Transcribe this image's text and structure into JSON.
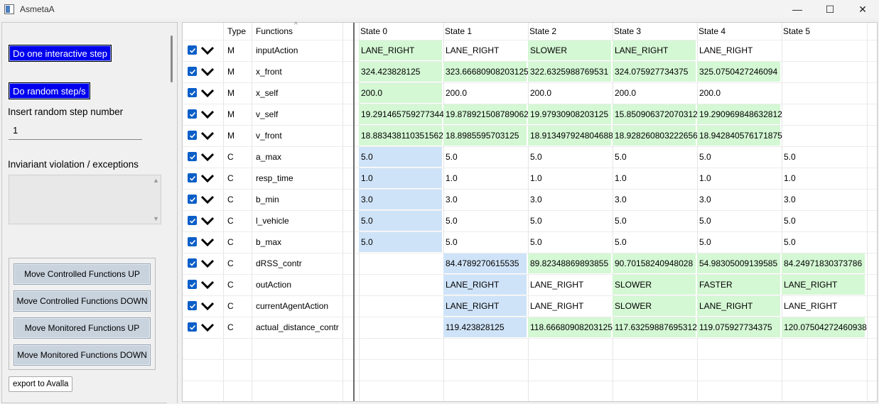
{
  "window": {
    "title": "AsmetaA",
    "minimize": "—",
    "maximize": "☐",
    "close": "✕"
  },
  "left": {
    "interactive_step_label": "Do one interactive step",
    "random_step_label": "Do random step/s",
    "random_step_number_label": "Insert random step number",
    "random_step_number_value": "1",
    "violation_label": "Inviariant violation / exceptions",
    "move_buttons": [
      "Move Controlled Functions UP",
      "Move Controlled Functions DOWN",
      "Move Monitored Functions UP",
      "Move Monitored Functions DOWN"
    ],
    "export_label": "export to Avalla"
  },
  "table": {
    "col_type": "Type",
    "col_functions": "Functions",
    "states": [
      "State 0",
      "State 1",
      "State 2",
      "State 3",
      "State 4",
      "State 5"
    ],
    "colors": {
      "green": "#d4f7d4",
      "blue": "#cfe3f8"
    },
    "rows": [
      {
        "type": "M",
        "name": "inputAction",
        "cells": [
          {
            "v": "LANE_RIGHT",
            "c": "green"
          },
          {
            "v": "LANE_RIGHT",
            "c": ""
          },
          {
            "v": "SLOWER",
            "c": "green"
          },
          {
            "v": "LANE_RIGHT",
            "c": "green"
          },
          {
            "v": "LANE_RIGHT",
            "c": ""
          },
          {
            "v": "",
            "c": ""
          }
        ]
      },
      {
        "type": "M",
        "name": "x_front",
        "cells": [
          {
            "v": "324.423828125",
            "c": "green"
          },
          {
            "v": "323.66680908203125",
            "c": "green"
          },
          {
            "v": "322.6325988769531",
            "c": "green"
          },
          {
            "v": "324.075927734375",
            "c": "green"
          },
          {
            "v": "325.0750427246094",
            "c": "green"
          },
          {
            "v": "",
            "c": ""
          }
        ]
      },
      {
        "type": "M",
        "name": "x_self",
        "cells": [
          {
            "v": "200.0",
            "c": "green"
          },
          {
            "v": "200.0",
            "c": ""
          },
          {
            "v": "200.0",
            "c": ""
          },
          {
            "v": "200.0",
            "c": ""
          },
          {
            "v": "200.0",
            "c": ""
          },
          {
            "v": "",
            "c": ""
          }
        ]
      },
      {
        "type": "M",
        "name": "v_self",
        "cells": [
          {
            "v": "19.291465759277344",
            "c": "green"
          },
          {
            "v": "19.878921508789062",
            "c": "green"
          },
          {
            "v": "19.97930908203125",
            "c": "green"
          },
          {
            "v": "15.850906372070312",
            "c": "green"
          },
          {
            "v": "19.290969848632812",
            "c": "green"
          },
          {
            "v": "",
            "c": ""
          }
        ]
      },
      {
        "type": "M",
        "name": "v_front",
        "cells": [
          {
            "v": "18.883438110351562",
            "c": "green"
          },
          {
            "v": "18.8985595703125",
            "c": "green"
          },
          {
            "v": "18.913497924804688",
            "c": "green"
          },
          {
            "v": "18.928260803222656",
            "c": "green"
          },
          {
            "v": "18.942840576171875",
            "c": "green"
          },
          {
            "v": "",
            "c": ""
          }
        ]
      },
      {
        "type": "C",
        "name": "a_max",
        "cells": [
          {
            "v": "5.0",
            "c": "blue"
          },
          {
            "v": "5.0",
            "c": ""
          },
          {
            "v": "5.0",
            "c": ""
          },
          {
            "v": "5.0",
            "c": ""
          },
          {
            "v": "5.0",
            "c": ""
          },
          {
            "v": "5.0",
            "c": ""
          }
        ]
      },
      {
        "type": "C",
        "name": "resp_time",
        "cells": [
          {
            "v": "1.0",
            "c": "blue"
          },
          {
            "v": "1.0",
            "c": ""
          },
          {
            "v": "1.0",
            "c": ""
          },
          {
            "v": "1.0",
            "c": ""
          },
          {
            "v": "1.0",
            "c": ""
          },
          {
            "v": "1.0",
            "c": ""
          }
        ]
      },
      {
        "type": "C",
        "name": "b_min",
        "cells": [
          {
            "v": "3.0",
            "c": "blue"
          },
          {
            "v": "3.0",
            "c": ""
          },
          {
            "v": "3.0",
            "c": ""
          },
          {
            "v": "3.0",
            "c": ""
          },
          {
            "v": "3.0",
            "c": ""
          },
          {
            "v": "3.0",
            "c": ""
          }
        ]
      },
      {
        "type": "C",
        "name": "l_vehicle",
        "cells": [
          {
            "v": "5.0",
            "c": "blue"
          },
          {
            "v": "5.0",
            "c": ""
          },
          {
            "v": "5.0",
            "c": ""
          },
          {
            "v": "5.0",
            "c": ""
          },
          {
            "v": "5.0",
            "c": ""
          },
          {
            "v": "5.0",
            "c": ""
          }
        ]
      },
      {
        "type": "C",
        "name": "b_max",
        "cells": [
          {
            "v": "5.0",
            "c": "blue"
          },
          {
            "v": "5.0",
            "c": ""
          },
          {
            "v": "5.0",
            "c": ""
          },
          {
            "v": "5.0",
            "c": ""
          },
          {
            "v": "5.0",
            "c": ""
          },
          {
            "v": "5.0",
            "c": ""
          }
        ]
      },
      {
        "type": "C",
        "name": "dRSS_contr",
        "cells": [
          {
            "v": "",
            "c": ""
          },
          {
            "v": "84.4789270615535",
            "c": "blue"
          },
          {
            "v": "89.82348869893855",
            "c": "green"
          },
          {
            "v": "90.70158240948028",
            "c": "green"
          },
          {
            "v": "54.98305009139585",
            "c": "green"
          },
          {
            "v": "84.24971830373786",
            "c": "green"
          }
        ]
      },
      {
        "type": "C",
        "name": "outAction",
        "cells": [
          {
            "v": "",
            "c": ""
          },
          {
            "v": "LANE_RIGHT",
            "c": "blue"
          },
          {
            "v": "LANE_RIGHT",
            "c": ""
          },
          {
            "v": "SLOWER",
            "c": "green"
          },
          {
            "v": "FASTER",
            "c": "green"
          },
          {
            "v": "LANE_RIGHT",
            "c": "green"
          }
        ]
      },
      {
        "type": "C",
        "name": "currentAgentAction",
        "cells": [
          {
            "v": "",
            "c": ""
          },
          {
            "v": "LANE_RIGHT",
            "c": "blue"
          },
          {
            "v": "LANE_RIGHT",
            "c": ""
          },
          {
            "v": "SLOWER",
            "c": "green"
          },
          {
            "v": "LANE_RIGHT",
            "c": "green"
          },
          {
            "v": "LANE_RIGHT",
            "c": ""
          }
        ]
      },
      {
        "type": "C",
        "name": "actual_distance_contr",
        "cells": [
          {
            "v": "",
            "c": ""
          },
          {
            "v": "119.423828125",
            "c": "blue"
          },
          {
            "v": "118.66680908203125",
            "c": "green"
          },
          {
            "v": "117.63259887695312",
            "c": "green"
          },
          {
            "v": "119.075927734375",
            "c": "green"
          },
          {
            "v": "120.07504272460938",
            "c": "green"
          }
        ]
      }
    ]
  }
}
